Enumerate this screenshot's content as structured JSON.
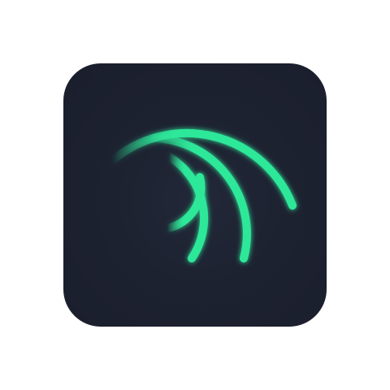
{
  "app_icon": {
    "icon_name": "alight-motion-swirl-icon",
    "colors": {
      "tile_background": "#1d2231",
      "arc_color": "#2ee89a",
      "arc_glow": "#1fd68a",
      "page_background": "#ffffff"
    }
  }
}
